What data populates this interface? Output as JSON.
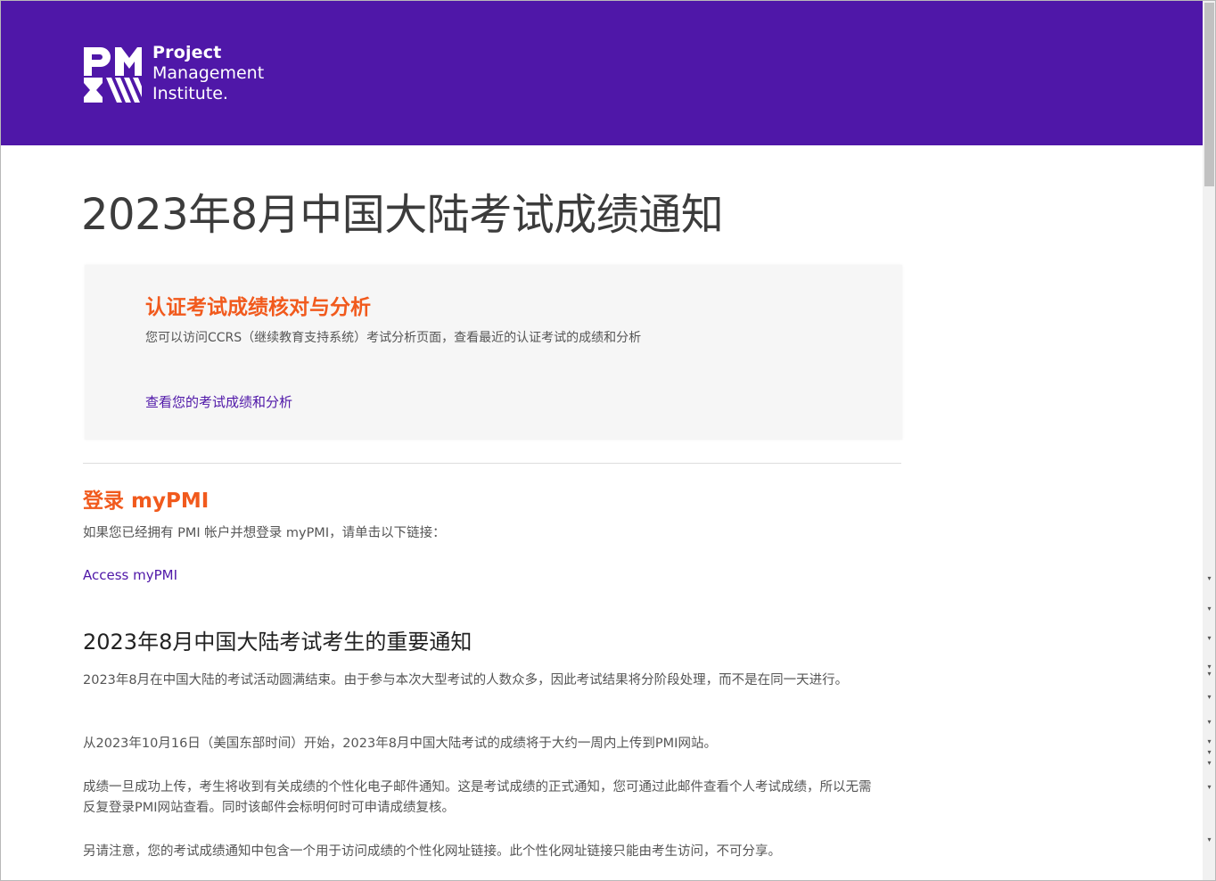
{
  "brand": {
    "line1": "Project",
    "line2": "Management",
    "line3": "Institute.",
    "header_color": "#4f17a8",
    "accent_color": "#f15a1d",
    "link_color": "#4f17a8"
  },
  "page": {
    "title": "2023年8月中国大陆考试成绩通知"
  },
  "ccrs_card": {
    "title": "认证考试成绩核对与分析",
    "description": "您可以访问CCRS（继续教育支持系统）考试分析页面，查看最近的认证考试的成绩和分析",
    "link": "查看您的考试成绩和分析"
  },
  "login": {
    "title": "登录 myPMI",
    "description": "如果您已经拥有 PMI 帐户并想登录 myPMI，请单击以下链接：",
    "link": "Access myPMI"
  },
  "notice": {
    "title": "2023年8月中国大陆考试考生的重要通知",
    "paragraphs": [
      "2023年8月在中国大陆的考试活动圆满结束。由于参与本次大型考试的人数众多，因此考试结果将分阶段处理，而不是在同一天进行。",
      "从2023年10月16日（美国东部时间）开始，2023年8月中国大陆考试的成绩将于大约一周内上传到PMI网站。",
      "成绩一旦成功上传，考生将收到有关成绩的个性化电子邮件通知。这是考试成绩的正式通知，您可通过此邮件查看个人考试成绩，所以无需反复登录PMI网站查看。同时该邮件会标明何时可申请成绩复核。",
      "另请注意，您的考试成绩通知中包含一个用于访问成绩的个性化网址链接。此个性化网址链接只能由考生访问，不可分享。"
    ]
  },
  "scrollbar": {
    "markers": [
      "▾",
      "▾",
      "▾",
      "▾",
      "▾",
      "▾",
      "▾",
      "▾",
      "▾",
      "▾",
      "▾",
      "▾"
    ]
  }
}
